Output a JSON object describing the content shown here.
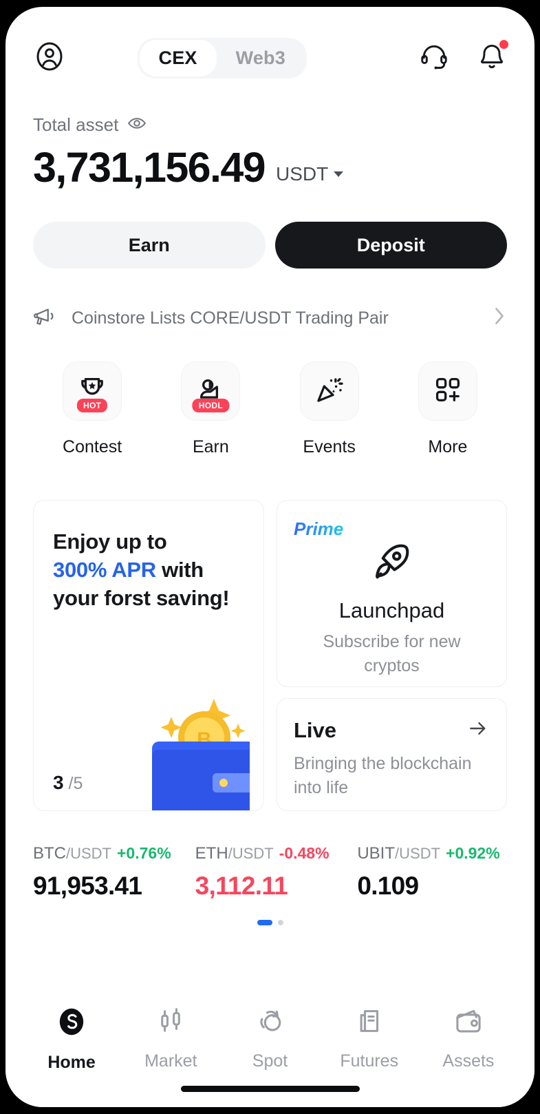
{
  "header": {
    "profile_icon": "user-circle-icon",
    "segments": [
      {
        "label": "CEX",
        "active": true
      },
      {
        "label": "Web3",
        "active": false
      }
    ],
    "support_icon": "headset-icon",
    "notification_icon": "bell-icon",
    "notification_has_dot": true
  },
  "balance": {
    "label": "Total asset",
    "eye_icon": "eye-icon",
    "amount": "3,731,156.49",
    "currency": "USDT"
  },
  "actions": {
    "earn_label": "Earn",
    "deposit_label": "Deposit"
  },
  "announcement": {
    "icon": "megaphone-icon",
    "text": "Coinstore Lists CORE/USDT Trading Pair",
    "chevron": "chevron-right-icon"
  },
  "quick_actions": [
    {
      "label": "Contest",
      "icon": "trophy-icon",
      "badge": "HOT"
    },
    {
      "label": "Earn",
      "icon": "hodl-hand-icon",
      "badge": "HODL"
    },
    {
      "label": "Events",
      "icon": "party-popper-icon",
      "badge": ""
    },
    {
      "label": "More",
      "icon": "grid-plus-icon",
      "badge": ""
    }
  ],
  "promo_card": {
    "line1": "Enjoy up to",
    "highlight": "300% APR",
    "line2_rest": " with",
    "line3": "your forst saving!",
    "current": "3",
    "total": "/5",
    "art_icon": "wallet-bitcoin-illustration"
  },
  "launchpad_card": {
    "tag": "Prime",
    "icon": "rocket-icon",
    "title": "Launchpad",
    "subtitle": "Subscribe for new cryptos"
  },
  "live_card": {
    "title": "Live",
    "arrow_icon": "arrow-right-icon",
    "subtitle": "Bringing the blockchain into life"
  },
  "tickers": [
    {
      "base": "BTC",
      "quote": "/USDT",
      "change": "+0.76%",
      "direction": "up",
      "price": "91,953.41",
      "price_direction": "neutral"
    },
    {
      "base": "ETH",
      "quote": "/USDT",
      "change": "-0.48%",
      "direction": "down",
      "price": "3,112.11",
      "price_direction": "down"
    },
    {
      "base": "UBIT",
      "quote": "/USDT",
      "change": "+0.92%",
      "direction": "up",
      "price": "0.109",
      "price_direction": "neutral"
    }
  ],
  "carousel": {
    "pages": 2,
    "active_index": 0
  },
  "bottom_nav": [
    {
      "label": "Home",
      "icon": "coinstore-logo-icon",
      "active": true
    },
    {
      "label": "Market",
      "icon": "candlestick-icon",
      "active": false
    },
    {
      "label": "Spot",
      "icon": "swap-circles-icon",
      "active": false
    },
    {
      "label": "Futures",
      "icon": "document-chart-icon",
      "active": false
    },
    {
      "label": "Assets",
      "icon": "wallet-icon",
      "active": false
    }
  ],
  "colors": {
    "accent_blue": "#2563ec",
    "up_green": "#18b86e",
    "down_red": "#f6465d",
    "badge_red": "#fc4257",
    "dark": "#17181c"
  }
}
